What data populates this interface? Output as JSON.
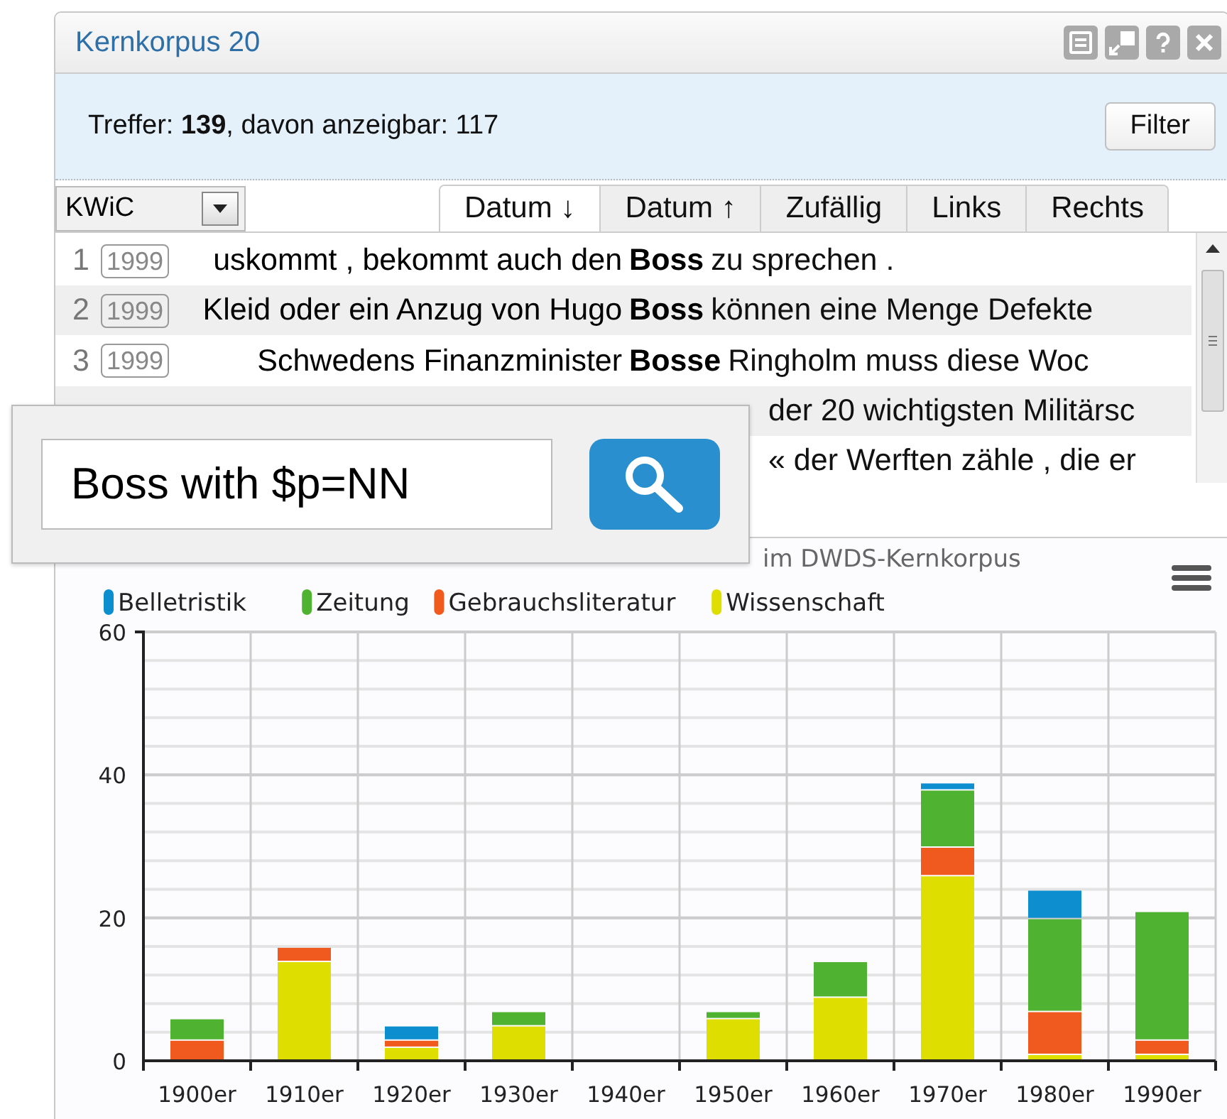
{
  "window": {
    "title": "Kernkorpus 20"
  },
  "summary": {
    "label": "Treffer: ",
    "hits": "139",
    "rest": ", davon anzeigbar: 117",
    "filter_button": "Filter"
  },
  "view_select": {
    "value": "KWiC"
  },
  "sort_tabs": [
    {
      "label": "Datum ↓",
      "selected": true
    },
    {
      "label": "Datum ↑",
      "selected": false
    },
    {
      "label": "Zufällig",
      "selected": false
    },
    {
      "label": "Links",
      "selected": false
    },
    {
      "label": "Rechts",
      "selected": false
    }
  ],
  "rows": [
    {
      "number": "1",
      "year": "1999",
      "left": "uskommt , bekommt auch den",
      "keyword": "Boss",
      "right": "zu sprechen ."
    },
    {
      "number": "2",
      "year": "1999",
      "left": "Kleid oder ein Anzug von Hugo",
      "keyword": "Boss",
      "right": "können eine Menge Defekte"
    },
    {
      "number": "3",
      "year": "1999",
      "left": "Schwedens Finanzminister",
      "keyword": "Bosse",
      "right": "Ringholm muss diese Woc"
    },
    {
      "right": "der 20 wichtigsten Militärsc"
    },
    {
      "right": "« der Werften zähle , die er"
    }
  ],
  "search": {
    "value": "Boss with $p=NN"
  },
  "chart": {
    "chart_data": {
      "type": "bar",
      "title": "im DWDS-Kernkorpus",
      "stacked": true,
      "categories": [
        "1900er",
        "1910er",
        "1920er",
        "1930er",
        "1940er",
        "1950er",
        "1960er",
        "1970er",
        "1980er",
        "1990er"
      ],
      "series": [
        {
          "name": "Belletristik",
          "color": "#0d8ecf",
          "values": [
            0,
            0,
            2,
            0,
            0,
            0,
            0,
            1,
            4,
            0
          ]
        },
        {
          "name": "Zeitung",
          "color": "#4fb230",
          "values": [
            3,
            0,
            0,
            2,
            0,
            1,
            5,
            8,
            13,
            18
          ]
        },
        {
          "name": "Gebrauchsliteratur",
          "color": "#f05a1e",
          "values": [
            3,
            2,
            1,
            0,
            0,
            0,
            0,
            4,
            6,
            2
          ]
        },
        {
          "name": "Wissenschaft",
          "color": "#dede00",
          "values": [
            0,
            14,
            2,
            5,
            0,
            6,
            9,
            26,
            1,
            1
          ]
        }
      ],
      "legend": "top",
      "ylim": [
        0,
        60
      ],
      "yticks": [
        0,
        20,
        40,
        60
      ]
    }
  }
}
